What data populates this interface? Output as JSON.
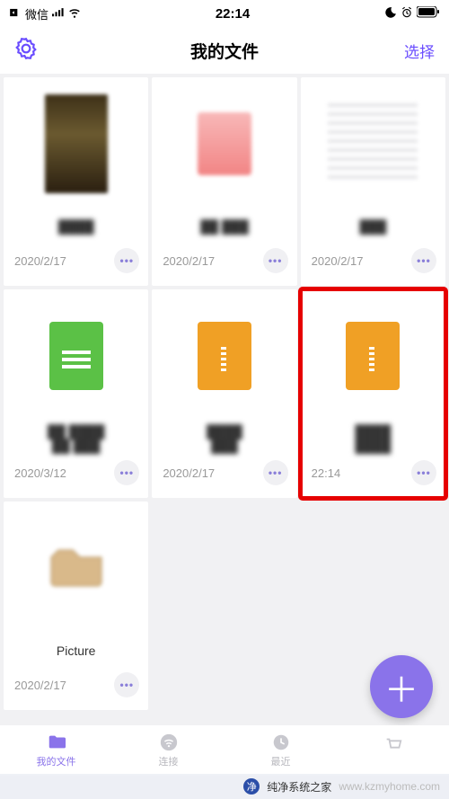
{
  "status": {
    "carrier": "微信",
    "time": "22:14"
  },
  "nav": {
    "title": "我的文件",
    "select": "选择"
  },
  "files": [
    {
      "date": "2020/2/17"
    },
    {
      "date": "2020/2/17"
    },
    {
      "date": "2020/2/17"
    },
    {
      "date": "2020/3/12"
    },
    {
      "date": "2020/2/17"
    },
    {
      "date": "22:14"
    },
    {
      "name": "Picture",
      "date": "2020/2/17"
    }
  ],
  "tabs": {
    "files": "我的文件",
    "connect": "连接",
    "recent": "最近"
  },
  "watermark": {
    "text": "纯净系统之家",
    "url": "www.kzmyhome.com"
  }
}
